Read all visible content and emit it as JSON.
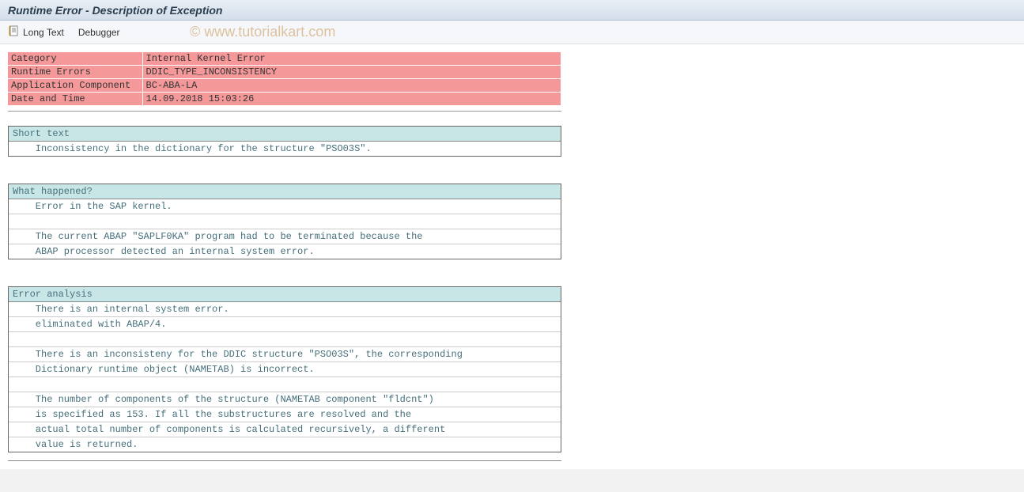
{
  "window": {
    "title": "Runtime Error - Description of Exception"
  },
  "toolbar": {
    "long_text_label": "Long Text",
    "debugger_label": "Debugger"
  },
  "info": {
    "rows": [
      {
        "label": "Category",
        "value": "Internal Kernel Error"
      },
      {
        "label": "Runtime Errors",
        "value": "DDIC_TYPE_INCONSISTENCY"
      },
      {
        "label": "Application Component",
        "value": "BC-ABA-LA"
      },
      {
        "label": "Date and Time",
        "value": "14.09.2018 15:03:26"
      }
    ]
  },
  "sections": {
    "short_text": {
      "title": "Short text",
      "lines": [
        "    Inconsistency in the dictionary for the structure \"PSO03S\"."
      ]
    },
    "what_happened": {
      "title": "What happened?",
      "lines": [
        "    Error in the SAP kernel.",
        "",
        "    The current ABAP \"SAPLF0KA\" program had to be terminated because the",
        "    ABAP processor detected an internal system error."
      ]
    },
    "error_analysis": {
      "title": "Error analysis",
      "lines": [
        "    There is an internal system error.",
        "    eliminated with ABAP/4.",
        "",
        "    There is an inconsisteny for the DDIC structure \"PSO03S\", the corresponding",
        "    Dictionary runtime object (NAMETAB) is incorrect.",
        "",
        "    The number of components of the structure (NAMETAB component \"fldcnt\")",
        "    is specified as 153. If all the substructures are resolved and the",
        "    actual total number of components is calculated recursively, a different",
        "    value is returned."
      ]
    }
  },
  "watermark": "© www.tutorialkart.com"
}
